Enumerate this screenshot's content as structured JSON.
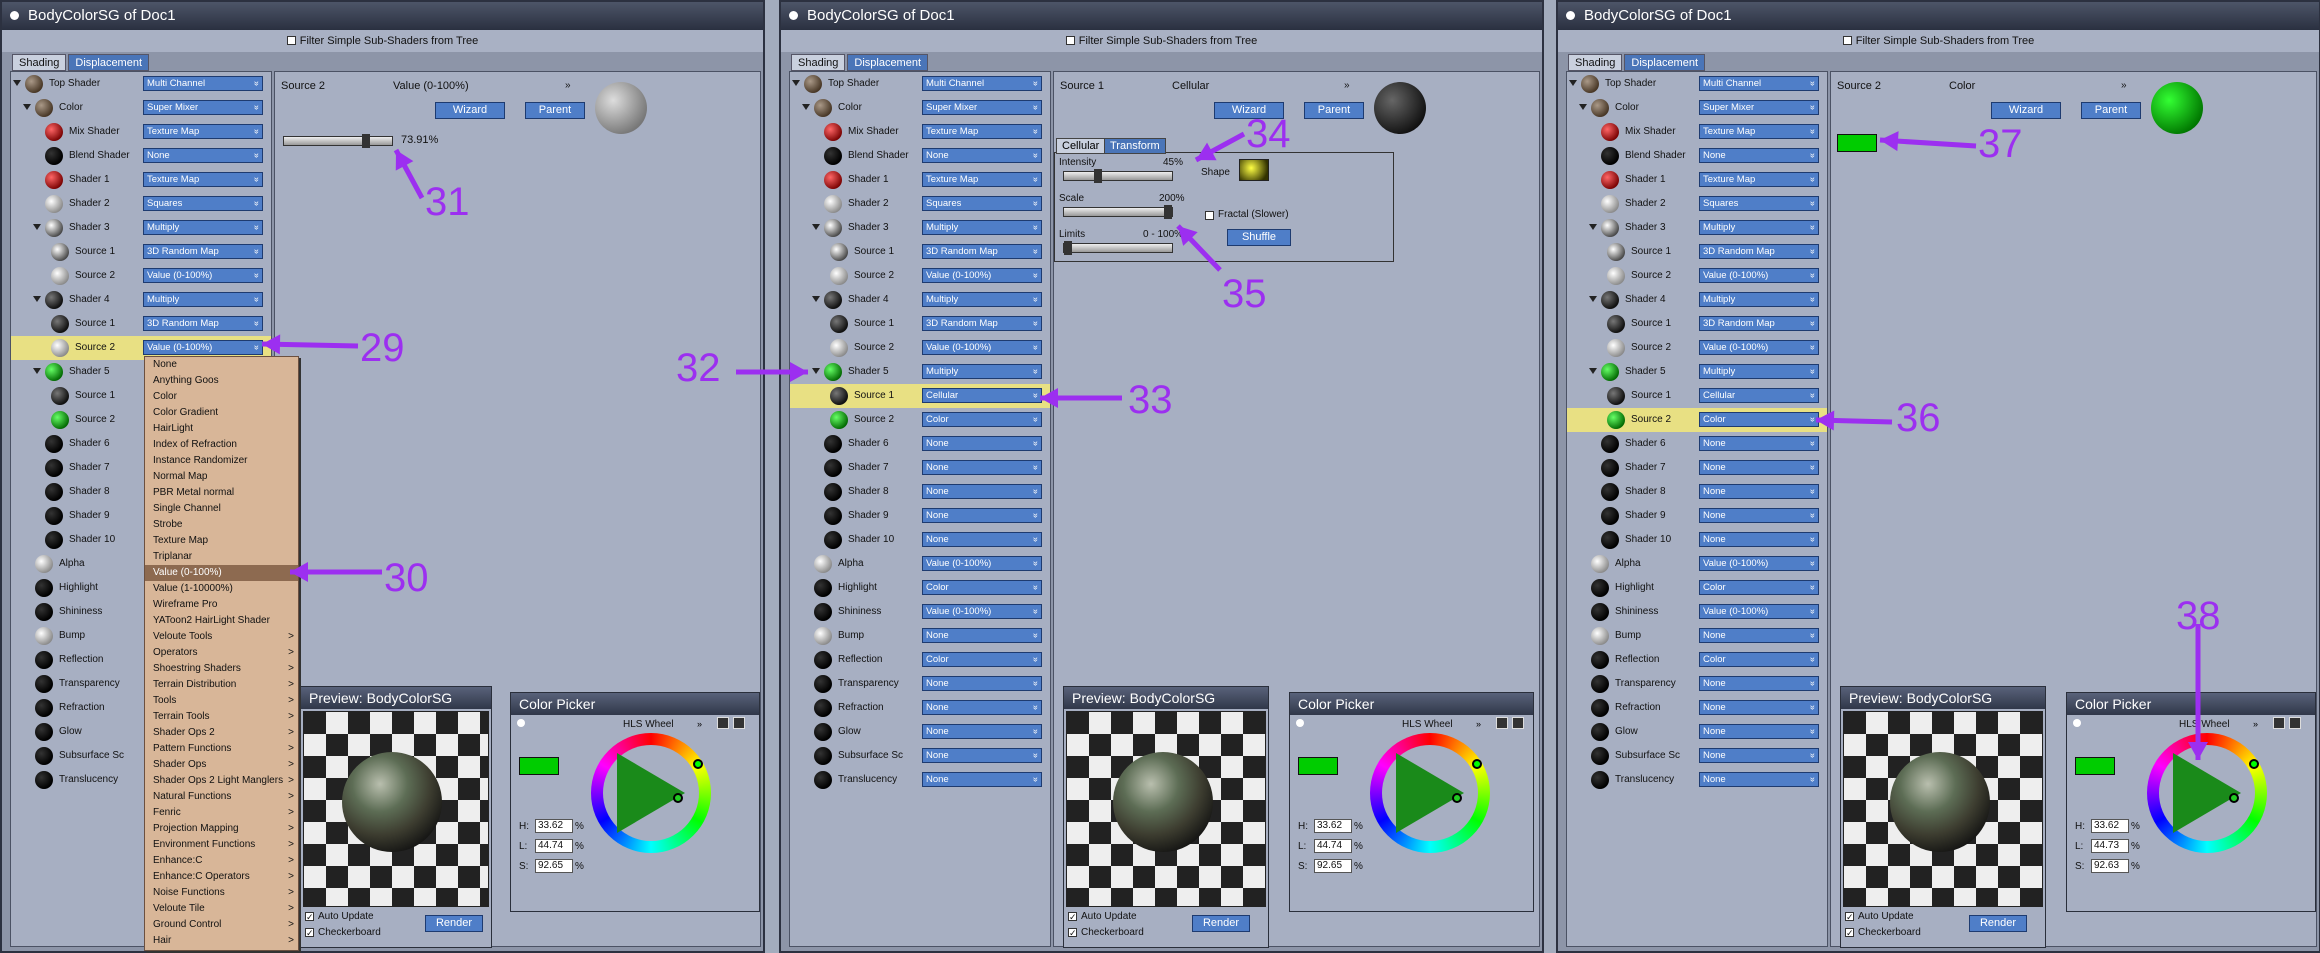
{
  "windows": [
    {
      "title": "BodyColorSG of Doc1",
      "filter": "Filter Simple Sub-Shaders from Tree",
      "tabs": [
        "Shading",
        "Displacement"
      ],
      "rows": [
        {
          "label": "Top Shader",
          "value": "Multi Channel",
          "ball": "brown",
          "indent": 0
        },
        {
          "label": "Color",
          "value": "Super Mixer",
          "ball": "brown",
          "indent": 1
        },
        {
          "label": "Mix Shader",
          "value": "Texture Map",
          "ball": "red",
          "indent": 2
        },
        {
          "label": "Blend Shader",
          "value": "None",
          "ball": "black",
          "indent": 2
        },
        {
          "label": "Shader 1",
          "value": "Texture Map",
          "ball": "red",
          "indent": 2
        },
        {
          "label": "Shader 2",
          "value": "Squares",
          "ball": "grey",
          "indent": 2
        },
        {
          "label": "Shader 3",
          "value": "Multiply",
          "ball": "speck",
          "indent": 2
        },
        {
          "label": "Source 1",
          "value": "3D Random Map",
          "ball": "speck",
          "indent": 3
        },
        {
          "label": "Source 2",
          "value": "Value (0-100%)",
          "ball": "grey",
          "indent": 3
        },
        {
          "label": "Shader 4",
          "value": "Multiply",
          "ball": "dark",
          "indent": 2
        },
        {
          "label": "Source 1",
          "value": "3D Random Map",
          "ball": "dark",
          "indent": 3
        },
        {
          "label": "Source 2",
          "value": "Value (0-100%)",
          "ball": "grey",
          "indent": 3,
          "hl": true
        },
        {
          "label": "Shader 5",
          "value": "",
          "ball": "green",
          "indent": 2
        },
        {
          "label": "Source 1",
          "value": "",
          "ball": "dark",
          "indent": 3
        },
        {
          "label": "Source 2",
          "value": "",
          "ball": "green",
          "indent": 3
        },
        {
          "label": "Shader 6",
          "value": "",
          "ball": "black",
          "indent": 2
        },
        {
          "label": "Shader 7",
          "value": "",
          "ball": "black",
          "indent": 2
        },
        {
          "label": "Shader 8",
          "value": "",
          "ball": "black",
          "indent": 2
        },
        {
          "label": "Shader 9",
          "value": "",
          "ball": "black",
          "indent": 2
        },
        {
          "label": "Shader 10",
          "value": "",
          "ball": "black",
          "indent": 2
        },
        {
          "label": "Alpha",
          "value": "",
          "ball": "grey",
          "indent": 1
        },
        {
          "label": "Highlight",
          "value": "",
          "ball": "black",
          "indent": 1
        },
        {
          "label": "Shininess",
          "value": "",
          "ball": "black",
          "indent": 1
        },
        {
          "label": "Bump",
          "value": "",
          "ball": "grey",
          "indent": 1
        },
        {
          "label": "Reflection",
          "value": "",
          "ball": "black",
          "indent": 1
        },
        {
          "label": "Transparency",
          "value": "",
          "ball": "black",
          "indent": 1
        },
        {
          "label": "Refraction",
          "value": "",
          "ball": "black",
          "indent": 1
        },
        {
          "label": "Glow",
          "value": "",
          "ball": "black",
          "indent": 1
        },
        {
          "label": "Subsurface Sc",
          "value": "",
          "ball": "black",
          "indent": 1
        },
        {
          "label": "Translucency",
          "value": "",
          "ball": "black",
          "indent": 1
        }
      ],
      "source_title": "Source 2",
      "source_value": "Value (0-100%)",
      "wizard": "Wizard",
      "parent": "Parent",
      "slider_pct": "73.91%",
      "preview_title": "Preview: BodyColorSG",
      "render": "Render",
      "auto_update": "Auto Update",
      "checkerboard": "Checkerboard",
      "picker_title": "Color Picker",
      "hls": "HLS Wheel",
      "h": "33.62",
      "l": "44.74",
      "s": "92.65",
      "menu": [
        "None",
        "Anything Goos",
        "Color",
        "Color Gradient",
        "HairLight",
        "Index of Refraction",
        "Instance Randomizer",
        "Normal Map",
        "PBR Metal normal",
        "Single Channel",
        "Strobe",
        "Texture Map",
        "Triplanar",
        "Value (0-100%)",
        "Value (1-10000%)",
        "Wireframe Pro",
        "YAToon2 HairLight Shader",
        "Veloute Tools",
        "Operators",
        "Shoestring Shaders",
        "Terrain Distribution",
        "Tools",
        "Terrain Tools",
        "Shader Ops 2",
        "Pattern Functions",
        "Shader Ops",
        "Shader Ops 2 Light Manglers",
        "Natural Functions",
        "Fenric",
        "Projection Mapping",
        "Environment Functions",
        "Enhance:C",
        "Enhance:C Operators",
        "Noise Functions",
        "Veloute Tile",
        "Ground Control",
        "Hair"
      ],
      "menu_sub": [
        false,
        false,
        false,
        false,
        false,
        false,
        false,
        false,
        false,
        false,
        false,
        false,
        false,
        false,
        false,
        false,
        false,
        true,
        true,
        true,
        true,
        true,
        true,
        true,
        true,
        true,
        true,
        true,
        true,
        true,
        true,
        true,
        true,
        true,
        true,
        true,
        true
      ],
      "annotations": [
        "29",
        "30",
        "31"
      ]
    },
    {
      "title": "BodyColorSG of Doc1",
      "filter": "Filter Simple Sub-Shaders from Tree",
      "tabs": [
        "Shading",
        "Displacement"
      ],
      "rows": [
        {
          "label": "Top Shader",
          "value": "Multi Channel",
          "ball": "brown",
          "indent": 0
        },
        {
          "label": "Color",
          "value": "Super Mixer",
          "ball": "brown",
          "indent": 1
        },
        {
          "label": "Mix Shader",
          "value": "Texture Map",
          "ball": "red",
          "indent": 2
        },
        {
          "label": "Blend Shader",
          "value": "None",
          "ball": "black",
          "indent": 2
        },
        {
          "label": "Shader 1",
          "value": "Texture Map",
          "ball": "red",
          "indent": 2
        },
        {
          "label": "Shader 2",
          "value": "Squares",
          "ball": "grey",
          "indent": 2
        },
        {
          "label": "Shader 3",
          "value": "Multiply",
          "ball": "speck",
          "indent": 2
        },
        {
          "label": "Source 1",
          "value": "3D Random Map",
          "ball": "speck",
          "indent": 3
        },
        {
          "label": "Source 2",
          "value": "Value (0-100%)",
          "ball": "grey",
          "indent": 3
        },
        {
          "label": "Shader 4",
          "value": "Multiply",
          "ball": "dark",
          "indent": 2
        },
        {
          "label": "Source 1",
          "value": "3D Random Map",
          "ball": "dark",
          "indent": 3
        },
        {
          "label": "Source 2",
          "value": "Value (0-100%)",
          "ball": "grey",
          "indent": 3
        },
        {
          "label": "Shader 5",
          "value": "Multiply",
          "ball": "green",
          "indent": 2
        },
        {
          "label": "Source 1",
          "value": "Cellular",
          "ball": "dark",
          "indent": 3,
          "hl": true
        },
        {
          "label": "Source 2",
          "value": "Color",
          "ball": "green",
          "indent": 3
        },
        {
          "label": "Shader 6",
          "value": "None",
          "ball": "black",
          "indent": 2
        },
        {
          "label": "Shader 7",
          "value": "None",
          "ball": "black",
          "indent": 2
        },
        {
          "label": "Shader 8",
          "value": "None",
          "ball": "black",
          "indent": 2
        },
        {
          "label": "Shader 9",
          "value": "None",
          "ball": "black",
          "indent": 2
        },
        {
          "label": "Shader 10",
          "value": "None",
          "ball": "black",
          "indent": 2
        },
        {
          "label": "Alpha",
          "value": "Value (0-100%)",
          "ball": "grey",
          "indent": 1
        },
        {
          "label": "Highlight",
          "value": "Color",
          "ball": "black",
          "indent": 1
        },
        {
          "label": "Shininess",
          "value": "Value (0-100%)",
          "ball": "black",
          "indent": 1
        },
        {
          "label": "Bump",
          "value": "None",
          "ball": "grey",
          "indent": 1
        },
        {
          "label": "Reflection",
          "value": "Color",
          "ball": "black",
          "indent": 1
        },
        {
          "label": "Transparency",
          "value": "None",
          "ball": "black",
          "indent": 1
        },
        {
          "label": "Refraction",
          "value": "None",
          "ball": "black",
          "indent": 1
        },
        {
          "label": "Glow",
          "value": "None",
          "ball": "black",
          "indent": 1
        },
        {
          "label": "Subsurface Sc",
          "value": "None",
          "ball": "black",
          "indent": 1
        },
        {
          "label": "Translucency",
          "value": "None",
          "ball": "black",
          "indent": 1
        }
      ],
      "source_title": "Source 1",
      "source_value": "Cellular",
      "wizard": "Wizard",
      "parent": "Parent",
      "cell_tabs": [
        "Cellular",
        "Transform"
      ],
      "intensity_label": "Intensity",
      "intensity": "45%",
      "shape": "Shape",
      "scale_label": "Scale",
      "scale": "200%",
      "limits_label": "Limits",
      "limits": "0 - 100%",
      "fractal": "Fractal (Slower)",
      "shuffle": "Shuffle",
      "preview_title": "Preview: BodyColorSG",
      "render": "Render",
      "auto_update": "Auto Update",
      "checkerboard": "Checkerboard",
      "picker_title": "Color Picker",
      "hls": "HLS Wheel",
      "h": "33.62",
      "l": "44.74",
      "s": "92.65",
      "annotations": [
        "32",
        "33",
        "34",
        "35"
      ]
    },
    {
      "title": "BodyColorSG of Doc1",
      "filter": "Filter Simple Sub-Shaders from Tree",
      "tabs": [
        "Shading",
        "Displacement"
      ],
      "rows": [
        {
          "label": "Top Shader",
          "value": "Multi Channel",
          "ball": "brown",
          "indent": 0
        },
        {
          "label": "Color",
          "value": "Super Mixer",
          "ball": "brown",
          "indent": 1
        },
        {
          "label": "Mix Shader",
          "value": "Texture Map",
          "ball": "red",
          "indent": 2
        },
        {
          "label": "Blend Shader",
          "value": "None",
          "ball": "black",
          "indent": 2
        },
        {
          "label": "Shader 1",
          "value": "Texture Map",
          "ball": "red",
          "indent": 2
        },
        {
          "label": "Shader 2",
          "value": "Squares",
          "ball": "grey",
          "indent": 2
        },
        {
          "label": "Shader 3",
          "value": "Multiply",
          "ball": "speck",
          "indent": 2
        },
        {
          "label": "Source 1",
          "value": "3D Random Map",
          "ball": "speck",
          "indent": 3
        },
        {
          "label": "Source 2",
          "value": "Value (0-100%)",
          "ball": "grey",
          "indent": 3
        },
        {
          "label": "Shader 4",
          "value": "Multiply",
          "ball": "dark",
          "indent": 2
        },
        {
          "label": "Source 1",
          "value": "3D Random Map",
          "ball": "dark",
          "indent": 3
        },
        {
          "label": "Source 2",
          "value": "Value (0-100%)",
          "ball": "grey",
          "indent": 3
        },
        {
          "label": "Shader 5",
          "value": "Multiply",
          "ball": "green",
          "indent": 2
        },
        {
          "label": "Source 1",
          "value": "Cellular",
          "ball": "dark",
          "indent": 3
        },
        {
          "label": "Source 2",
          "value": "Color",
          "ball": "green",
          "indent": 3,
          "hl": true
        },
        {
          "label": "Shader 6",
          "value": "None",
          "ball": "black",
          "indent": 2
        },
        {
          "label": "Shader 7",
          "value": "None",
          "ball": "black",
          "indent": 2
        },
        {
          "label": "Shader 8",
          "value": "None",
          "ball": "black",
          "indent": 2
        },
        {
          "label": "Shader 9",
          "value": "None",
          "ball": "black",
          "indent": 2
        },
        {
          "label": "Shader 10",
          "value": "None",
          "ball": "black",
          "indent": 2
        },
        {
          "label": "Alpha",
          "value": "Value (0-100%)",
          "ball": "grey",
          "indent": 1
        },
        {
          "label": "Highlight",
          "value": "Color",
          "ball": "black",
          "indent": 1
        },
        {
          "label": "Shininess",
          "value": "Value (0-100%)",
          "ball": "black",
          "indent": 1
        },
        {
          "label": "Bump",
          "value": "None",
          "ball": "grey",
          "indent": 1
        },
        {
          "label": "Reflection",
          "value": "Color",
          "ball": "black",
          "indent": 1
        },
        {
          "label": "Transparency",
          "value": "None",
          "ball": "black",
          "indent": 1
        },
        {
          "label": "Refraction",
          "value": "None",
          "ball": "black",
          "indent": 1
        },
        {
          "label": "Glow",
          "value": "None",
          "ball": "black",
          "indent": 1
        },
        {
          "label": "Subsurface Sc",
          "value": "None",
          "ball": "black",
          "indent": 1
        },
        {
          "label": "Translucency",
          "value": "None",
          "ball": "black",
          "indent": 1
        }
      ],
      "source_title": "Source 2",
      "source_value": "Color",
      "wizard": "Wizard",
      "parent": "Parent",
      "preview_title": "Preview: BodyColorSG",
      "render": "Render",
      "auto_update": "Auto Update",
      "checkerboard": "Checkerboard",
      "picker_title": "Color Picker",
      "hls": "HLS Wheel",
      "h": "33.62",
      "l": "44.73",
      "s": "92.63",
      "annotations": [
        "36",
        "37",
        "38"
      ]
    }
  ],
  "colors": {
    "annotation": "#9c2ff0",
    "dropdown": "#4f7ec8",
    "highlight": "#e8e083",
    "swatch": "#00cc00"
  }
}
